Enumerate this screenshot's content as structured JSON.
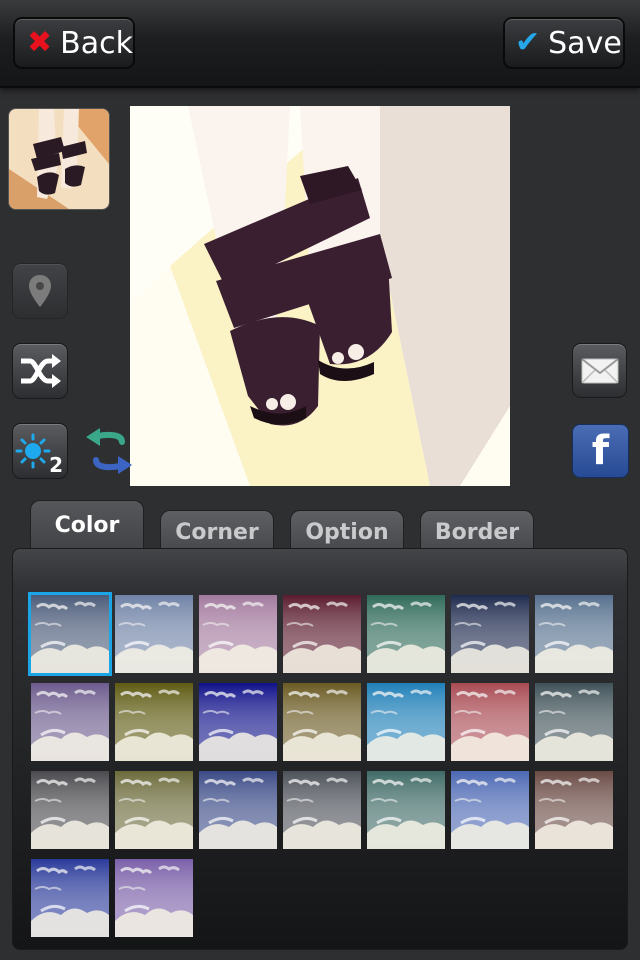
{
  "header": {
    "back_label": "Back",
    "back_icon": "x-icon",
    "save_label": "Save",
    "save_icon": "checkmark-icon"
  },
  "tools": {
    "brightness_level": "2",
    "facebook_glyph": "f",
    "icons": [
      "location-pin-icon",
      "shuffle-icon",
      "brightness-icon",
      "undo-redo-icon",
      "mail-icon",
      "facebook-icon"
    ]
  },
  "tabs": [
    {
      "label": "Color",
      "active": true
    },
    {
      "label": "Corner",
      "active": false
    },
    {
      "label": "Option",
      "active": false
    },
    {
      "label": "Border",
      "active": false
    }
  ],
  "filters": {
    "selected_index": 0,
    "count": 23,
    "accent_color": "#1aa6e6",
    "tints": [
      "#4a5a78",
      "#6f82a6",
      "#a37a9e",
      "#5a1b2e",
      "#2f6a58",
      "#1e2a4e",
      "#56708e",
      "#6b5a8c",
      "#5e5a12",
      "#10118a",
      "#6a5a22",
      "#1f7fb8",
      "#a84a52",
      "#3f5258",
      "#4a4a4e",
      "#6b6a3a",
      "#3a4a86",
      "#4c5058",
      "#3f6a66",
      "#4b67b3",
      "#6a4a44",
      "#2a3a9a",
      "#7a5fa8"
    ]
  },
  "colors": {
    "brand_red": "#e8121e",
    "brand_blue": "#26a7e8",
    "facebook_blue": "#3b5998"
  }
}
